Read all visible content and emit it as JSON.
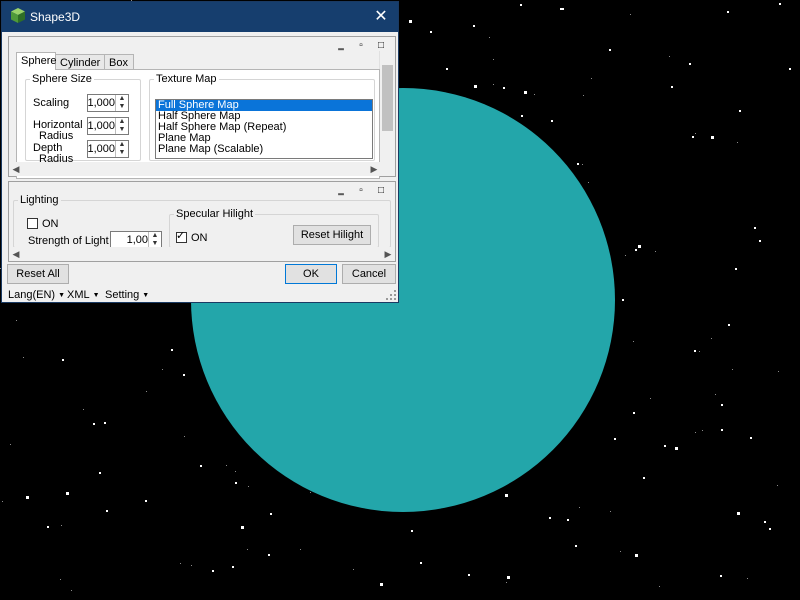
{
  "window": {
    "title": "Shape3D",
    "close_glyph": "✕"
  },
  "panel_controls": [
    "‗",
    "▫",
    "□"
  ],
  "tabs": [
    {
      "label": "Sphere",
      "active": true
    },
    {
      "label": "Cylinder",
      "active": false
    },
    {
      "label": "Box",
      "active": false
    }
  ],
  "sphere_size": {
    "legend": "Sphere Size",
    "scaling_label": "Scaling",
    "scaling_value": "1,000",
    "hradius_label_1": "Horizontal",
    "hradius_label_2": "Radius",
    "hradius_value": "1,000",
    "dradius_label_1": "Depth",
    "dradius_label_2": "Radius",
    "dradius_value": "1,000"
  },
  "texture_map": {
    "legend": "Texture Map",
    "items": [
      "Full Sphere Map",
      "Half Sphere Map",
      "Half Sphere Map (Repeat)",
      "Plane Map",
      "Plane Map (Scalable)"
    ],
    "selected_index": 0
  },
  "lighting": {
    "legend": "Lighting",
    "on_label": "ON",
    "on_checked": false,
    "strength_label": "Strength of Light",
    "strength_value": "1,00"
  },
  "specular": {
    "legend": "Specular Hilight",
    "on_label": "ON",
    "on_checked": true,
    "reset_label": "Reset Hilight"
  },
  "footer": {
    "reset_all": "Reset All",
    "ok": "OK",
    "cancel": "Cancel"
  },
  "menu": [
    {
      "label": "Lang(EN)"
    },
    {
      "label": "XML"
    },
    {
      "label": "Setting"
    }
  ],
  "colors": {
    "background": "#000000",
    "sphere": "#23a6aa",
    "titlebar": "#163e6e",
    "selection": "#0a74d9"
  },
  "icons": {
    "app": "green-cube-icon",
    "close": "close-icon"
  }
}
